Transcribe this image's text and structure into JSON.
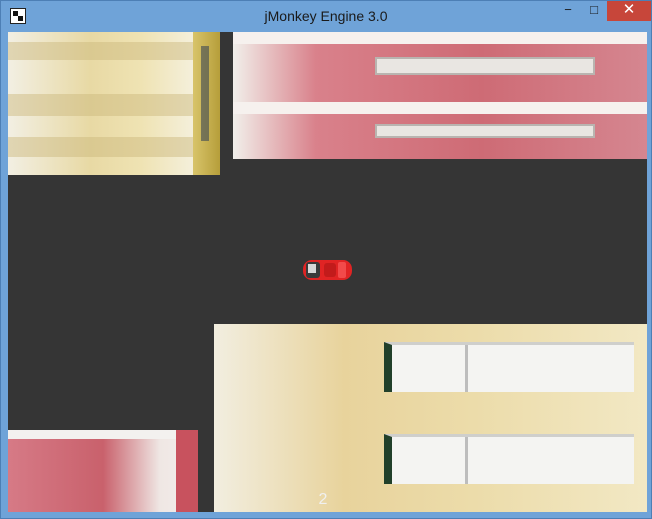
{
  "window": {
    "title": "jMonkey Engine 3.0",
    "controls": {
      "minimize": "−",
      "maximize": "□",
      "close": "✕"
    },
    "app_icon": "jmonkey-logo-icon"
  },
  "scene": {
    "description_colors": {
      "road": "#353535",
      "car": "#e02424",
      "accent_close": "#c7463a"
    },
    "hud": {
      "counter": "2"
    }
  }
}
